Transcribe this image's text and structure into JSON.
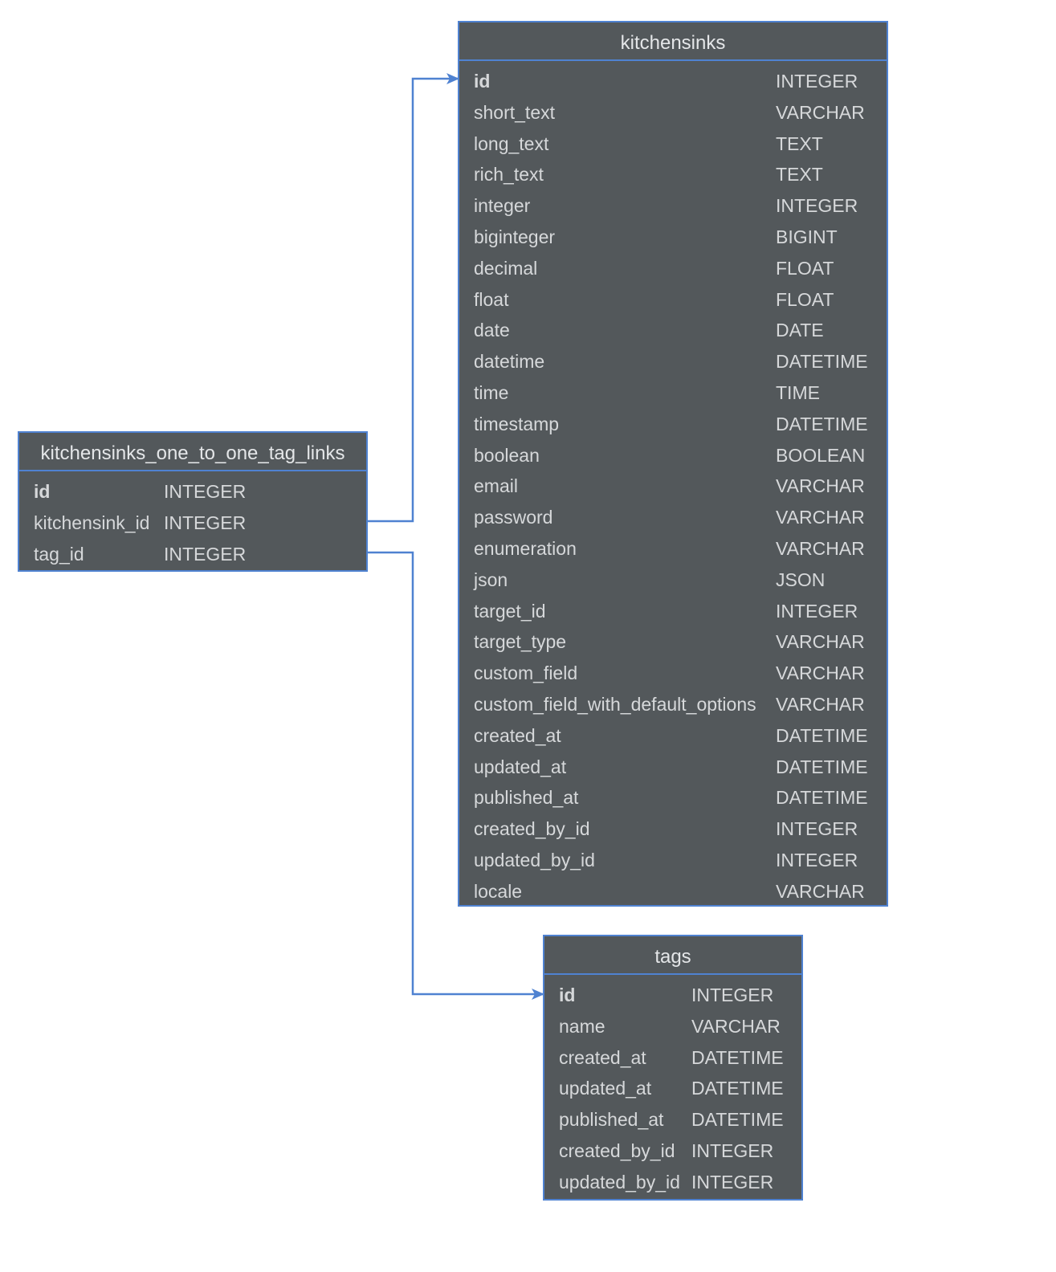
{
  "colors": {
    "table_fill": "#53585b",
    "border": "#4f82d1",
    "text": "#d6d8da",
    "edge": "#4f82d1",
    "background": "#ffffff"
  },
  "tables": {
    "links": {
      "name": "kitchensinks_one_to_one_tag_links",
      "columns": [
        {
          "name": "id",
          "type": "INTEGER",
          "pk": true
        },
        {
          "name": "kitchensink_id",
          "type": "INTEGER",
          "pk": false
        },
        {
          "name": "tag_id",
          "type": "INTEGER",
          "pk": false
        }
      ]
    },
    "kitchensinks": {
      "name": "kitchensinks",
      "columns": [
        {
          "name": "id",
          "type": "INTEGER",
          "pk": true
        },
        {
          "name": "short_text",
          "type": "VARCHAR",
          "pk": false
        },
        {
          "name": "long_text",
          "type": "TEXT",
          "pk": false
        },
        {
          "name": "rich_text",
          "type": "TEXT",
          "pk": false
        },
        {
          "name": "integer",
          "type": "INTEGER",
          "pk": false
        },
        {
          "name": "biginteger",
          "type": "BIGINT",
          "pk": false
        },
        {
          "name": "decimal",
          "type": "FLOAT",
          "pk": false
        },
        {
          "name": "float",
          "type": "FLOAT",
          "pk": false
        },
        {
          "name": "date",
          "type": "DATE",
          "pk": false
        },
        {
          "name": "datetime",
          "type": "DATETIME",
          "pk": false
        },
        {
          "name": "time",
          "type": "TIME",
          "pk": false
        },
        {
          "name": "timestamp",
          "type": "DATETIME",
          "pk": false
        },
        {
          "name": "boolean",
          "type": "BOOLEAN",
          "pk": false
        },
        {
          "name": "email",
          "type": "VARCHAR",
          "pk": false
        },
        {
          "name": "password",
          "type": "VARCHAR",
          "pk": false
        },
        {
          "name": "enumeration",
          "type": "VARCHAR",
          "pk": false
        },
        {
          "name": "json",
          "type": "JSON",
          "pk": false
        },
        {
          "name": "target_id",
          "type": "INTEGER",
          "pk": false
        },
        {
          "name": "target_type",
          "type": "VARCHAR",
          "pk": false
        },
        {
          "name": "custom_field",
          "type": "VARCHAR",
          "pk": false
        },
        {
          "name": "custom_field_with_default_options",
          "type": "VARCHAR",
          "pk": false
        },
        {
          "name": "created_at",
          "type": "DATETIME",
          "pk": false
        },
        {
          "name": "updated_at",
          "type": "DATETIME",
          "pk": false
        },
        {
          "name": "published_at",
          "type": "DATETIME",
          "pk": false
        },
        {
          "name": "created_by_id",
          "type": "INTEGER",
          "pk": false
        },
        {
          "name": "updated_by_id",
          "type": "INTEGER",
          "pk": false
        },
        {
          "name": "locale",
          "type": "VARCHAR",
          "pk": false
        }
      ]
    },
    "tags": {
      "name": "tags",
      "columns": [
        {
          "name": "id",
          "type": "INTEGER",
          "pk": true
        },
        {
          "name": "name",
          "type": "VARCHAR",
          "pk": false
        },
        {
          "name": "created_at",
          "type": "DATETIME",
          "pk": false
        },
        {
          "name": "updated_at",
          "type": "DATETIME",
          "pk": false
        },
        {
          "name": "published_at",
          "type": "DATETIME",
          "pk": false
        },
        {
          "name": "created_by_id",
          "type": "INTEGER",
          "pk": false
        },
        {
          "name": "updated_by_id",
          "type": "INTEGER",
          "pk": false
        }
      ]
    }
  },
  "relations": [
    {
      "from_table": "links",
      "from_column": "kitchensink_id",
      "to_table": "kitchensinks",
      "to_column": "id"
    },
    {
      "from_table": "links",
      "from_column": "tag_id",
      "to_table": "tags",
      "to_column": "id"
    }
  ]
}
